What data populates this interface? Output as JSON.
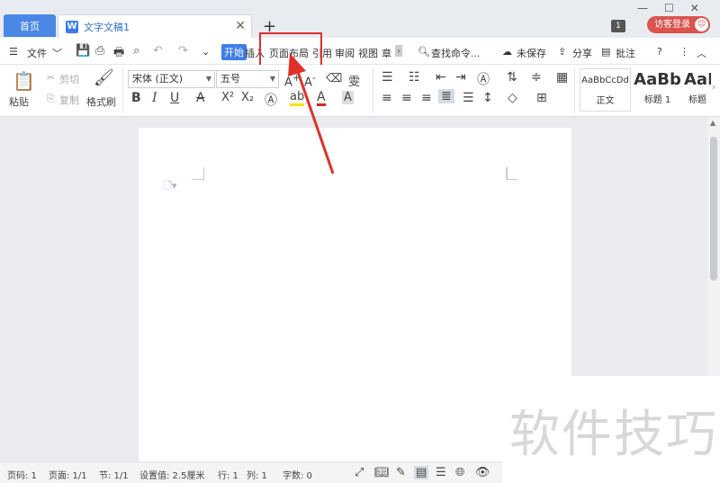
{
  "titlebar": {
    "home_tab": "首页",
    "doc_tab": "文字文稿1",
    "doc_icon": "W",
    "close": "✕",
    "add": "+",
    "badge": "1",
    "login": "访客登录",
    "win_min": "—",
    "win_max": "☐",
    "win_close": "✕"
  },
  "menubar": {
    "file": "文件",
    "tabs": [
      "开始",
      "插入",
      "页面布局",
      "引用",
      "审阅",
      "视图",
      "章"
    ],
    "search": "查找命令...",
    "unsaved": "未保存",
    "share": "分享",
    "comment": "批注",
    "help": "?"
  },
  "ribbon": {
    "paste": "粘贴",
    "cut": "剪切",
    "copy": "复制",
    "format_painter": "格式刷",
    "font_name": "宋体 (正文)",
    "font_size": "五号",
    "styles": [
      {
        "preview": "AaBbCcDd",
        "label": "正文"
      },
      {
        "preview": "AaBb",
        "label": "标题 1"
      },
      {
        "preview": "AaI",
        "label": "标题"
      }
    ]
  },
  "statusbar": {
    "page_no": "页码: 1",
    "pages": "页面: 1/1",
    "section": "节: 1/1",
    "position": "设置值: 2.5厘米",
    "row": "行: 1",
    "col": "列: 1",
    "words": "字数: 0"
  },
  "watermark": "软件技巧",
  "colors": {
    "accent": "#3f7ee8",
    "login": "#d9544f",
    "highlight": "#e0302b"
  }
}
